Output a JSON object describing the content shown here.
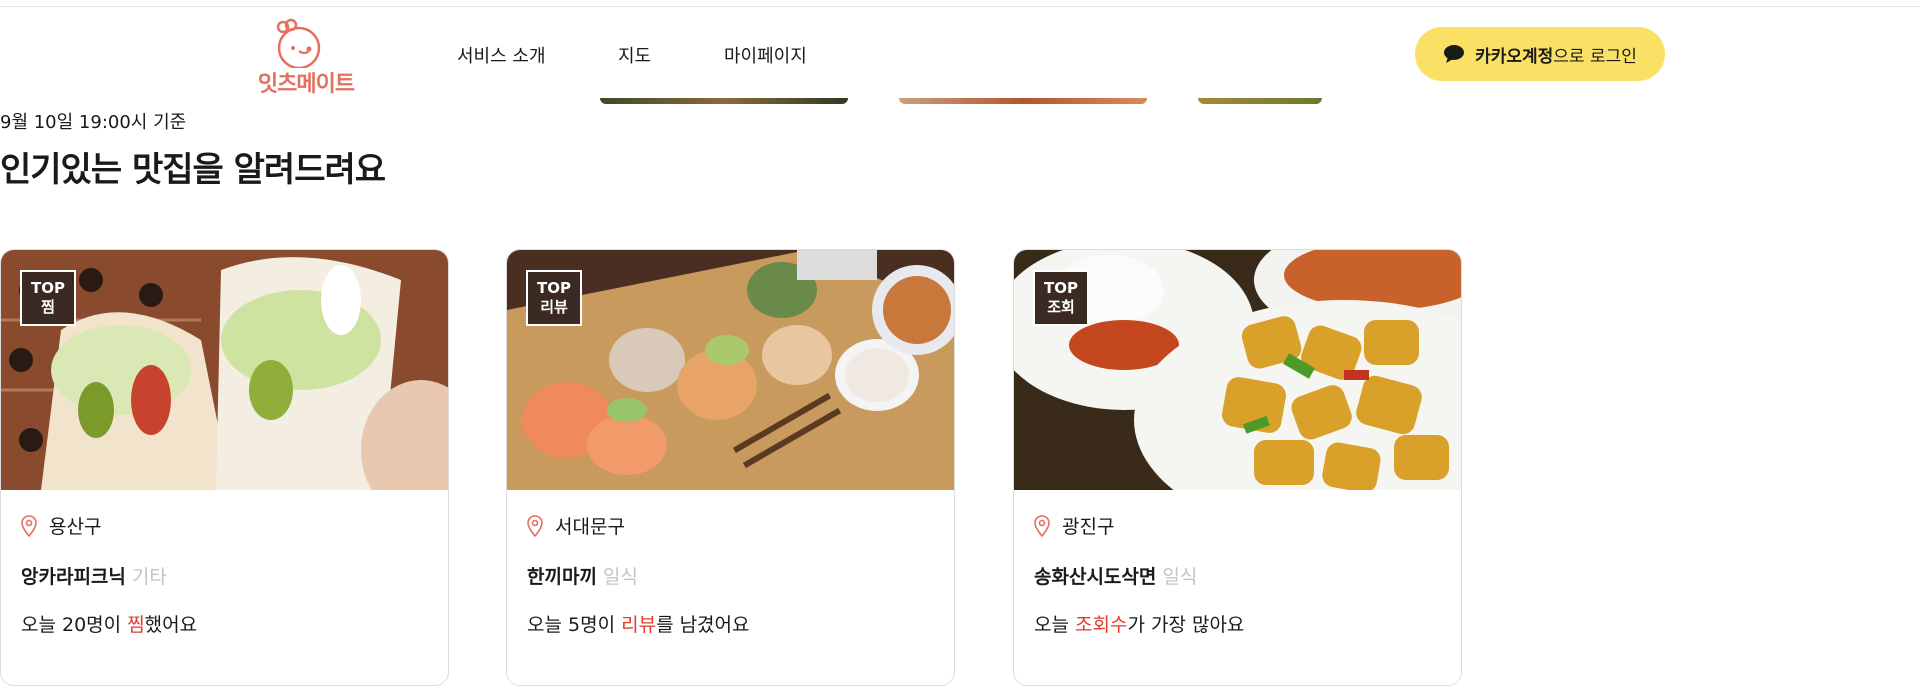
{
  "header": {
    "logo_text": "잇츠메이트",
    "nav": [
      "서비스 소개",
      "지도",
      "마이페이지"
    ],
    "login": {
      "bold": "카카오계정",
      "rest": "으로 로그인"
    }
  },
  "ranking": {
    "base_time": "9월 10일 19:00시 기준",
    "title": "인기있는 맛집을 알려드려요"
  },
  "cards": [
    {
      "badge_top": "TOP",
      "badge_kind": "찜",
      "district": "용산구",
      "name": "앙카라피크닉",
      "category": "기타",
      "msg_pre": "오늘 20명이 ",
      "msg_accent": "찜",
      "msg_post": "했어요"
    },
    {
      "badge_top": "TOP",
      "badge_kind": "리뷰",
      "district": "서대문구",
      "name": "한끼마끼",
      "category": "일식",
      "msg_pre": "오늘 5명이 ",
      "msg_accent": "리뷰",
      "msg_post": "를 남겼어요"
    },
    {
      "badge_top": "TOP",
      "badge_kind": "조회",
      "district": "광진구",
      "name": "송화산시도삭면",
      "category": "일식",
      "msg_pre": "오늘 ",
      "msg_accent": "조회수",
      "msg_post": "가 가장 많아요"
    }
  ],
  "colors": {
    "brand": "#e4705f",
    "kakao_yellow": "#fae064",
    "accent_red": "#e23b2a",
    "badge_brown": "#3b2a22",
    "muted": "#c4c4c4"
  },
  "icons": [
    "chef-logo-icon",
    "kakao-chat-icon",
    "location-pin-icon"
  ]
}
